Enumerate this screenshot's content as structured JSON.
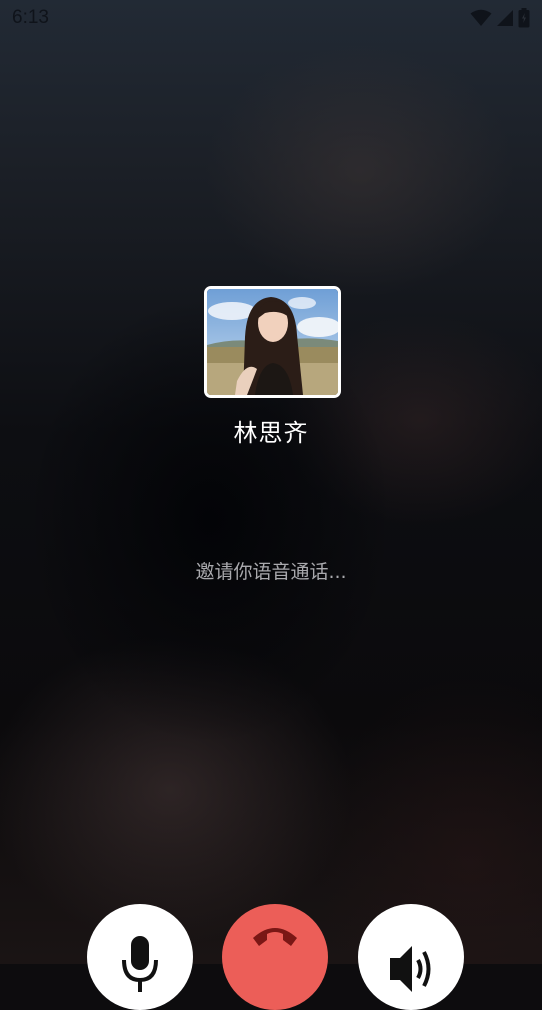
{
  "status_bar": {
    "time": "6:13",
    "icons": [
      "wifi-icon",
      "signal-icon",
      "battery-icon"
    ]
  },
  "caller": {
    "name": "林思齐",
    "avatar": "caller-avatar"
  },
  "call": {
    "status_text": "邀请你语音通话..."
  },
  "controls": [
    {
      "id": "mute",
      "icon": "microphone-icon",
      "color": "#ffffff"
    },
    {
      "id": "hangup",
      "icon": "phone-hangup-icon",
      "color": "#ec5e58"
    },
    {
      "id": "speaker",
      "icon": "speaker-icon",
      "color": "#ffffff"
    }
  ]
}
